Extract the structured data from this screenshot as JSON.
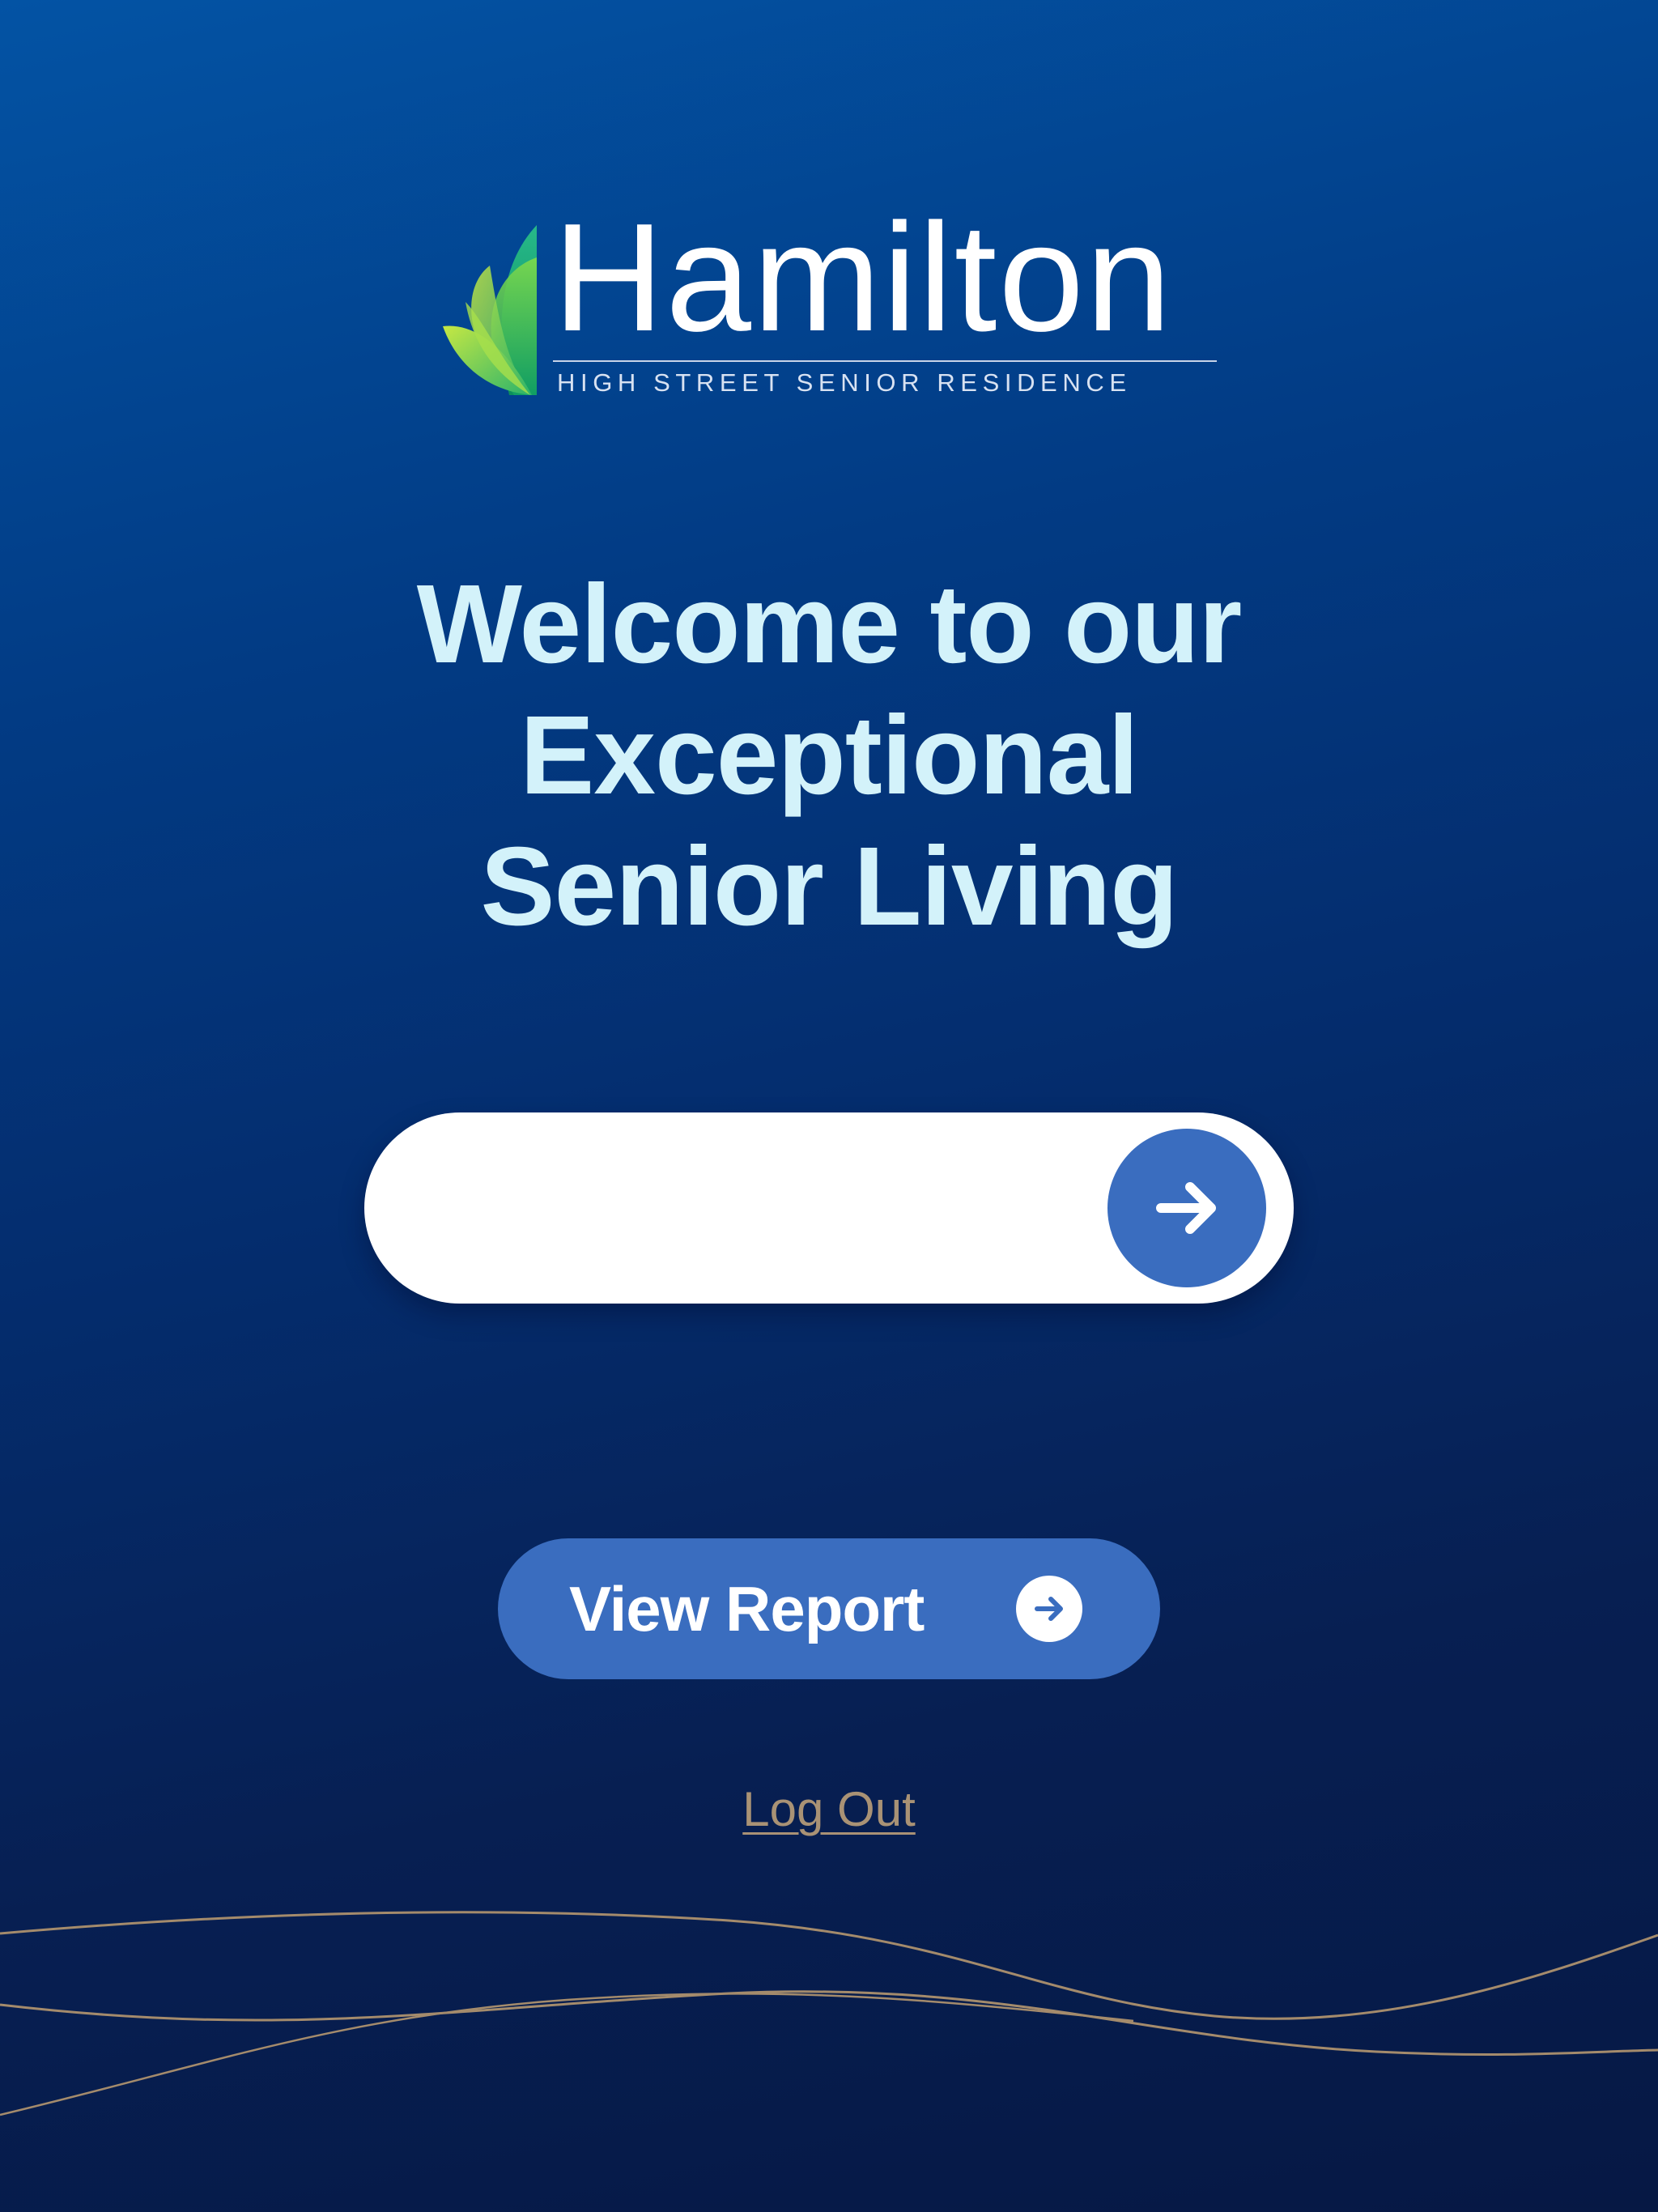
{
  "brand": {
    "name": "Hamilton",
    "tagline": "HIGH STREET SENIOR RESIDENCE"
  },
  "headline": {
    "line1": "Welcome to our",
    "line2": "Exceptional",
    "line3": "Senior Living"
  },
  "entry": {
    "value": "",
    "placeholder": "",
    "submit_icon": "arrow-right-icon"
  },
  "report_button": {
    "label": "View Report",
    "icon": "arrow-right-circle-icon"
  },
  "logout": {
    "label": "Log Out"
  },
  "colors": {
    "background_top": "#0353a4",
    "background_bottom": "#061844",
    "headline": "#d3f2fa",
    "accent_blue": "#3a6dbf",
    "gold": "#a99275"
  }
}
